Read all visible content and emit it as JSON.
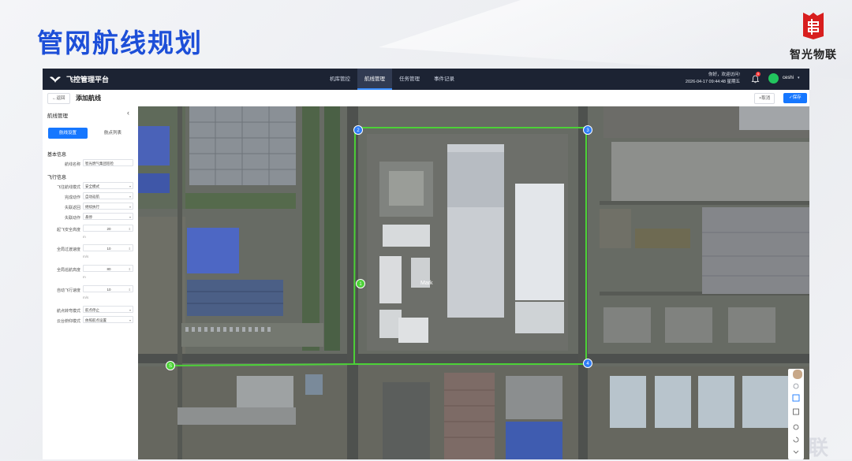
{
  "slide": {
    "title": "管网航线规划",
    "brand_name": "智光物联",
    "watermark": "联"
  },
  "topbar": {
    "app_title": "飞控管理平台",
    "nav": [
      "机库管控",
      "航线管理",
      "任务管理",
      "事件记录"
    ],
    "greeting": "你好，欢迎访问!",
    "datetime": "2026-04-17 09:44:48 星期五",
    "notifications": "5",
    "username": "ceshi"
  },
  "subbar": {
    "back": "←返回",
    "title": "添加航线",
    "cancel": "×取消",
    "save": "✓保存"
  },
  "panel": {
    "title": "航线管理",
    "tabs": [
      "航线设置",
      "航点列表"
    ],
    "section_basic": "基本信息",
    "route_name_label": "航线名称",
    "route_name_value": "智光燃气集团巡检",
    "section_flight": "飞行信息",
    "fields": [
      {
        "label": "飞往航线模式",
        "value": "安全模式"
      },
      {
        "label": "完成动作",
        "value": "自动返航"
      },
      {
        "label": "失联返回",
        "value": "继续执行"
      },
      {
        "label": "失联动作",
        "value": "悬停"
      },
      {
        "label": "起飞安全高度",
        "value": "20",
        "unit": "m"
      },
      {
        "label": "全局过渡速度",
        "value": "10",
        "unit": "m/s"
      },
      {
        "label": "全局巡航高度",
        "value": "80",
        "unit": "m"
      },
      {
        "label": "自动飞行速度",
        "value": "10",
        "unit": "m/s"
      },
      {
        "label": "航点转弯模式",
        "value": "航点停止"
      },
      {
        "label": "云台俯仰模式",
        "value": "依照航点设置"
      }
    ]
  },
  "map": {
    "marker_label": "Mark",
    "waypoints": [
      "2",
      "3",
      "4",
      "1",
      "S"
    ],
    "route_color": "#4cd137",
    "waypoint_color": "#2f7df6"
  },
  "colors": {
    "accent": "#1677ff",
    "title_blue": "#1d4fd8",
    "topbar": "#1c2333"
  }
}
